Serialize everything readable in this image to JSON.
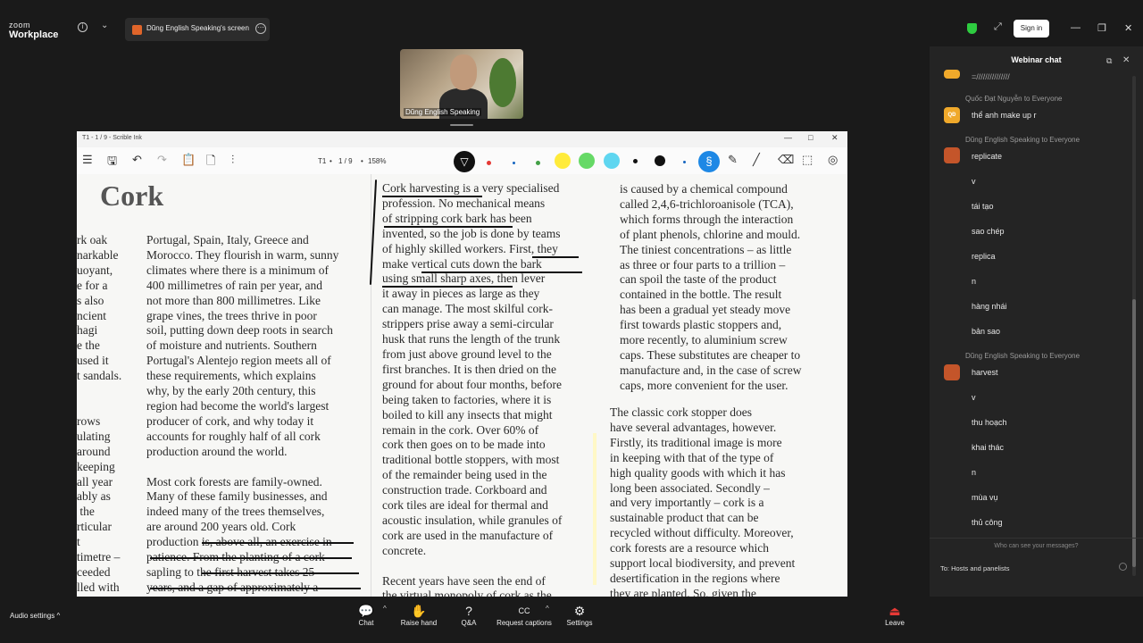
{
  "app": {
    "logo_top": "zoom",
    "logo_bottom": "Workplace"
  },
  "share_tab": {
    "label": "Dũng English Speaking's screen"
  },
  "header": {
    "sign_in": "Sign in",
    "info": "i",
    "chevron": "⌄",
    "more": "⋯",
    "expand": "⤢",
    "minimize": "—",
    "restore": "❐",
    "close": "✕"
  },
  "video": {
    "name": "Dũng English Speaking"
  },
  "ink_window": {
    "title": "T1 - 1 / 9 - Scrible Ink",
    "min": "—",
    "max": "□",
    "close": "✕",
    "page_label": "T1",
    "page_count": "1 / 9",
    "zoom": "158%",
    "toolbar_icons": [
      "menu-icon",
      "save-icon",
      "undo-icon",
      "redo-icon",
      "clipboard-icon",
      "page-icon",
      "sliders-icon"
    ]
  },
  "document": {
    "heading": "Cork",
    "col0": "rk oak\nnarkable\nuoyant,\ne for a\ns also\nncient\nhagi\ne the\nused it\nt sandals.\n\n\nrows\nulating\naround\nkeeping\nall year\nably as\n the\nrticular\nt\ntimetre –\nceeded\nlled with\nbught\nneans",
    "col1": "Portugal, Spain, Italy, Greece and\nMorocco. They flourish in warm, sunny\nclimates where there is a minimum of\n400 millimetres of rain per year, and\nnot more than 800 millimetres. Like\ngrape vines, the trees thrive in poor\nsoil, putting down deep roots in search\nof moisture and nutrients. Southern\nPortugal's Alentejo region meets all of\nthese requirements, which explains\nwhy, by the early 20th century, this\nregion had become the world's largest\nproducer of cork, and why today it\naccounts for roughly half of all cork\nproduction around the world.\n\nMost cork forests are family-owned.\nMany of these family businesses, and\nindeed many of the trees themselves,\nare around 200 years old. Cork\nproduction is, above all, an exercise in\npatience. From the planting of a cork\nsapling to the first harvest takes 25\nyears, and a gap of approximately a\ndecade must separate harvests from\nan individual tree. And for top-quality",
    "col2": "Cork harvesting is a very specialised\nprofession. No mechanical means\nof stripping cork bark has been\ninvented, so the job is done by teams\nof highly skilled workers. First, they\nmake vertical cuts down the bark\nusing small sharp axes, then lever\nit away in pieces as large as they\ncan manage. The most skilful cork-\nstrippers prise away a semi-circular\nhusk that runs the length of the trunk\nfrom just above ground level to the\nfirst branches. It is then dried on the\nground for about four months, before\nbeing taken to factories, where it is\nboiled to kill any insects that might\nremain in the cork. Over 60% of\ncork then goes on to be made into\ntraditional bottle stoppers, with most\nof the remainder being used in the\nconstruction trade. Corkboard and\ncork tiles are ideal for thermal and\nacoustic insulation, while granules of\ncork are used in the manufacture of\nconcrete.\n\nRecent years have seen the end of\nthe virtual monopoly of cork as the",
    "col3": "is caused by a chemical compound\ncalled 2,4,6-trichloroanisole (TCA),\nwhich forms through the interaction\nof plant phenols, chlorine and mould.\nThe tiniest concentrations – as little\nas three or four parts to a trillion –\ncan spoil the taste of the product\ncontained in the bottle. The result\nhas been a gradual yet steady move\nfirst towards plastic stoppers and,\nmore recently, to aluminium screw\ncaps. These substitutes are cheaper to\nmanufacture and, in the case of screw\ncaps, more convenient for the user.",
    "col4": "The classic cork stopper does\nhave several advantages, however.\nFirstly, its traditional image is more\nin keeping with that of the type of\nhigh quality goods with which it has\nlong been associated. Secondly –\nand very importantly – cork is a\nsustainable product that can be\nrecycled without difficulty. Moreover,\ncork forests are a resource which\nsupport local biodiversity, and prevent\ndesertification in the regions where\nthey are planted. So, given the"
  },
  "chat": {
    "title": "Webinar chat",
    "popout": "⧉",
    "close": "✕",
    "partial": "=///////////////",
    "messages": [
      {
        "from": "Quốc Đạt Nguyễn to Everyone",
        "avatar": "QĐ",
        "lines": [
          "thể anh make up  r"
        ]
      },
      {
        "from": "Dũng English Speaking to Everyone",
        "avatar": "",
        "lines": [
          "replicate",
          "v",
          "tái tạo",
          "sao chép",
          "replica",
          "n",
          "hàng nhái",
          "bản sao"
        ]
      },
      {
        "from": "Dũng English Speaking to Everyone",
        "avatar": "",
        "lines": [
          "harvest",
          "v",
          "thu hoạch",
          "khai thác",
          "n",
          "mùa vụ",
          "thủ công"
        ]
      }
    ],
    "who_can_see": "Who can see your messages?",
    "to": "To:  Hosts and panelists",
    "colors": {
      "avatar_qd": "#f0a92b",
      "avatar_dung": "#c4552a"
    }
  },
  "bottom_bar": {
    "audio_settings": "Audio settings",
    "caret": "^",
    "buttons": [
      {
        "label": "Chat",
        "icon": "chat-icon"
      },
      {
        "label": "Raise hand",
        "icon": "hand-icon"
      },
      {
        "label": "Q&A",
        "icon": "qa-icon"
      },
      {
        "label": "Request captions",
        "icon": "cc-icon"
      },
      {
        "label": "Settings",
        "icon": "gear-icon"
      },
      {
        "label": "Leave",
        "icon": "leave-icon"
      }
    ]
  },
  "icon_glyphs": {
    "menu": "☰",
    "save": "🖫",
    "undo": "↶",
    "redo": "↷",
    "clipboard": "📋",
    "page": "🗋",
    "sliders": "⫶",
    "pen": "▽",
    "lasso": "§",
    "pencil": "✎",
    "line": "╱",
    "eraser": "⌫",
    "select": "⬚",
    "eye": "◎",
    "chat": "💬",
    "hand": "✋",
    "qa": "?",
    "cc": "CC",
    "gear": "⚙",
    "leave": "⏏"
  }
}
